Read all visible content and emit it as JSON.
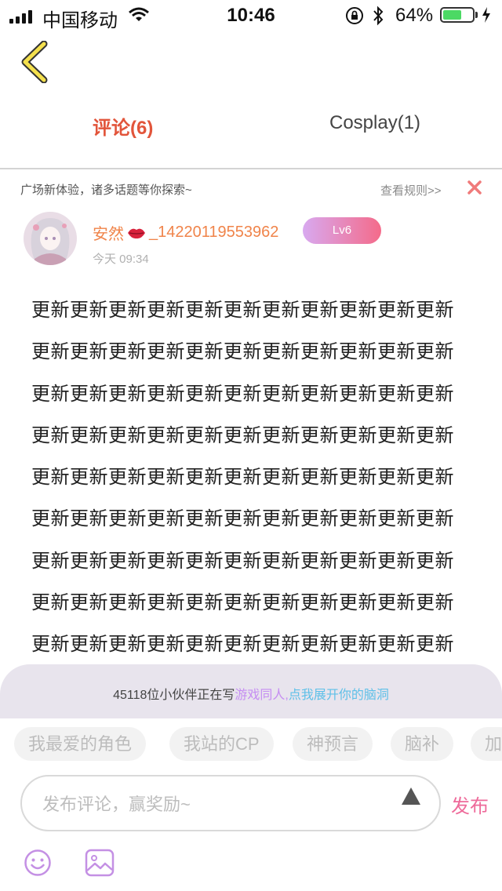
{
  "status_bar": {
    "carrier": "中国移动",
    "time": "10:46",
    "battery_percent": "64%",
    "battery_level": 0.64
  },
  "tabs": [
    {
      "label": "评论(6)",
      "active": true
    },
    {
      "label": "Cosplay(1)",
      "active": false
    }
  ],
  "notice": {
    "text": "广场新体验，诸多话题等你探索~",
    "rules_link": "查看规则>>"
  },
  "post": {
    "username_prefix": "安然",
    "username_suffix": "_14220119553962",
    "level": "Lv6",
    "time": "今天 09:34",
    "lines": [
      "更新更新更新更新更新更新更新更新更新更新更新",
      "更新更新更新更新更新更新更新更新更新更新更新",
      "更新更新更新更新更新更新更新更新更新更新更新",
      "更新更新更新更新更新更新更新更新更新更新更新",
      "更新更新更新更新更新更新更新更新更新更新更新",
      "更新更新更新更新更新更新更新更新更新更新更新",
      "更新更新更新更新更新更新更新更新更新更新更新",
      "更新更新更新更新更新更新更新更新更新更新更新",
      "更新更新更新更新更新更新更新更新更新更新更新"
    ]
  },
  "invite": {
    "prefix": "45118位小伙伴正在写",
    "purple": "游戏同人,",
    "blue": "点我展开你的脑洞"
  },
  "topics": [
    "我最爱的角色",
    "我站的CP",
    "神预言",
    "脑补",
    "加"
  ],
  "composer": {
    "placeholder": "发布评论，赢奖励~",
    "publish_label": "发布"
  },
  "colors": {
    "accent_red": "#e2553b",
    "publish_pink": "#ee6a9a",
    "username_orange": "#f0844a"
  }
}
